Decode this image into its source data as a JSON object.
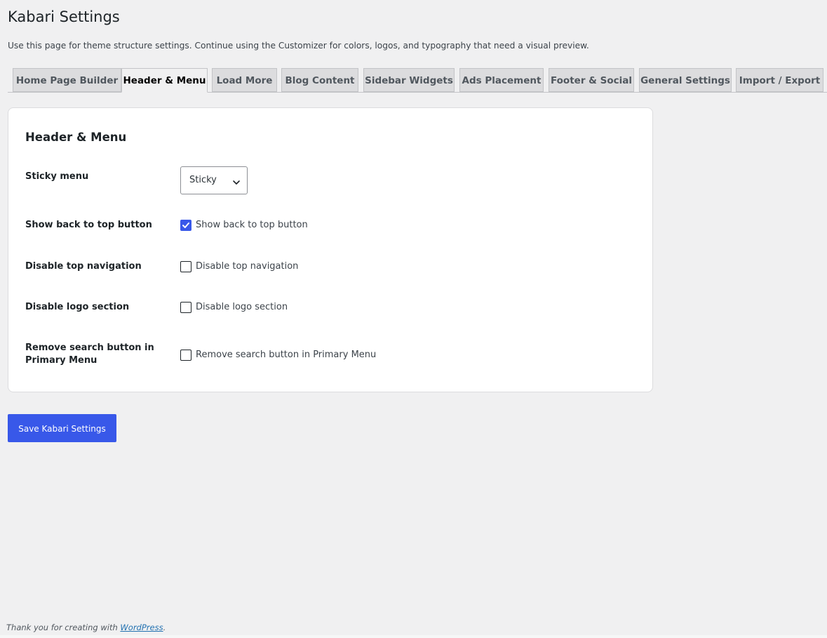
{
  "page": {
    "title": "Kabari Settings",
    "description": "Use this page for theme structure settings. Continue using the Customizer for colors, logos, and typography that need a visual preview."
  },
  "tabs": [
    {
      "label": "Home Page Builder",
      "active": false
    },
    {
      "label": "Header & Menu",
      "active": true
    },
    {
      "label": "Load More",
      "active": false
    },
    {
      "label": "Blog Content",
      "active": false
    },
    {
      "label": "Sidebar Widgets",
      "active": false
    },
    {
      "label": "Ads Placement",
      "active": false
    },
    {
      "label": "Footer & Social",
      "active": false
    },
    {
      "label": "General Settings",
      "active": false
    },
    {
      "label": "Import / Export",
      "active": false
    }
  ],
  "section": {
    "title": "Header & Menu",
    "sticky_menu": {
      "label": "Sticky menu",
      "value": "Sticky",
      "icon": "chevron-down-icon"
    },
    "back_to_top": {
      "label": "Show back to top button",
      "checkbox_label": "Show back to top button",
      "checked": true
    },
    "top_navigation": {
      "label": "Disable top navigation",
      "checkbox_label": "Disable top navigation",
      "checked": false
    },
    "logo_section": {
      "label": "Disable logo section",
      "checkbox_label": "Disable logo section",
      "checked": false
    },
    "search_button": {
      "label": "Remove search button in Primary Menu",
      "checkbox_label": "Remove search button in Primary Menu",
      "checked": false
    }
  },
  "actions": {
    "save_label": "Save Kabari Settings"
  },
  "footer": {
    "text": "Thank you for creating with",
    "link": "WordPress",
    "suffix": "."
  },
  "colors": {
    "accent": "#3858e9",
    "background": "#f0f0f1",
    "link": "#2271b1"
  }
}
